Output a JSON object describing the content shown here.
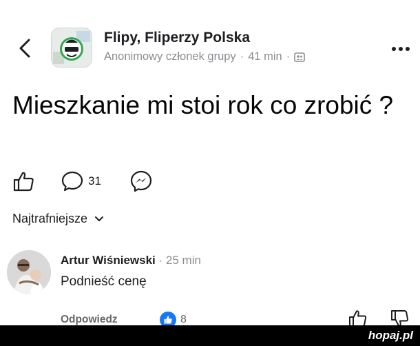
{
  "header": {
    "back_icon": "chevron-left-icon",
    "group_name": "Flipy, Fliperzy Polska",
    "author": "Anonimowy członek grupy",
    "separator": "·",
    "time": "41 min",
    "audience_icon": "group-audience-icon",
    "more_icon": "more-dots-icon"
  },
  "post": {
    "title": "Mieszkanie mi stoi rok co zrobić ?"
  },
  "actions": {
    "like_icon": "thumbs-up-icon",
    "comment_icon": "comment-bubble-icon",
    "comment_count": "31",
    "share_icon": "messenger-icon"
  },
  "sort": {
    "label": "Najtrafniejsze",
    "icon": "chevron-down-icon"
  },
  "comment": {
    "author": "Artur Wiśniewski",
    "separator": "·",
    "time": "25 min",
    "text": "Podnieść cenę",
    "reply_label": "Odpowiedz",
    "reaction_icon": "like-reaction-icon",
    "reaction_count": "8",
    "upvote_icon": "upvote-icon",
    "downvote_icon": "downvote-icon"
  },
  "watermark": "hopaj.pl",
  "colors": {
    "accent": "#1877f2",
    "meta_text": "#8a8d91",
    "footer": "#000000"
  }
}
